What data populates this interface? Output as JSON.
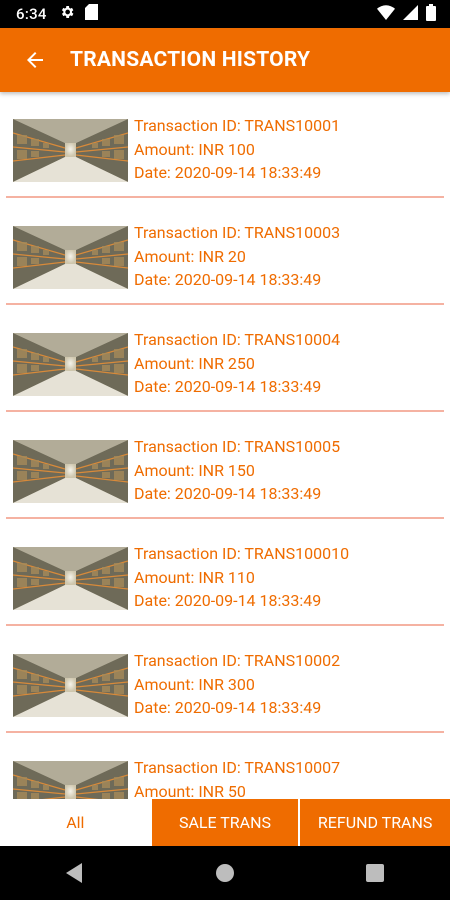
{
  "status": {
    "time": "6:34",
    "icons": [
      "gear-icon",
      "sd-card-icon",
      "wifi-icon",
      "signal-icon",
      "battery-icon"
    ]
  },
  "appbar": {
    "title": "TRANSACTION HISTORY",
    "back_icon": "arrow-left-icon",
    "color": "#ef6c00"
  },
  "transactions": [
    {
      "id": "Transaction ID: TRANS10001",
      "amount": "Amount: INR 100",
      "date": "Date: 2020-09-14 18:33:49"
    },
    {
      "id": "Transaction ID: TRANS10003",
      "amount": "Amount: INR 20",
      "date": "Date: 2020-09-14 18:33:49"
    },
    {
      "id": "Transaction ID: TRANS10004",
      "amount": "Amount: INR 250",
      "date": "Date: 2020-09-14 18:33:49"
    },
    {
      "id": "Transaction ID: TRANS10005",
      "amount": "Amount: INR 150",
      "date": "Date: 2020-09-14 18:33:49"
    },
    {
      "id": "Transaction ID: TRANS100010",
      "amount": "Amount: INR 110",
      "date": "Date: 2020-09-14 18:33:49"
    },
    {
      "id": "Transaction ID: TRANS10002",
      "amount": "Amount: INR 300",
      "date": "Date: 2020-09-14 18:33:49"
    },
    {
      "id": "Transaction ID: TRANS10007",
      "amount": "Amount: INR 50",
      "date": ""
    }
  ],
  "tabs": {
    "all": "All",
    "sale": "SALE TRANS",
    "refund": "REFUND TRANS"
  },
  "navbar": {
    "icons": [
      "back-triangle-icon",
      "home-circle-icon",
      "recents-square-icon"
    ]
  },
  "colors": {
    "accent": "#ef6c00",
    "divider": "#f5b2a2"
  }
}
